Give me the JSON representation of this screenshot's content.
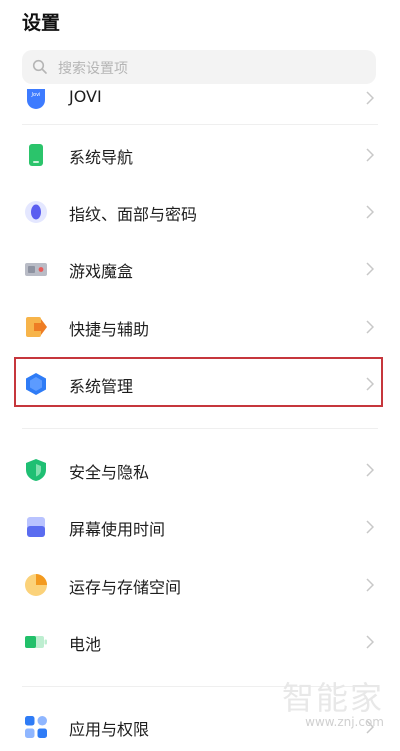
{
  "header": {
    "title": "设置"
  },
  "search": {
    "placeholder": "搜索设置项"
  },
  "menu": {
    "items": [
      {
        "label": "JOVI"
      },
      {
        "label": "系统导航"
      },
      {
        "label": "指纹、面部与密码"
      },
      {
        "label": "游戏魔盒"
      },
      {
        "label": "快捷与辅助"
      },
      {
        "label": "系统管理"
      },
      {
        "label": "安全与隐私"
      },
      {
        "label": "屏幕使用时间"
      },
      {
        "label": "运存与存储空间"
      },
      {
        "label": "电池"
      },
      {
        "label": "应用与权限"
      }
    ]
  },
  "watermark": {
    "brand": "智能家",
    "url": "www.znj.com"
  },
  "colors": {
    "highlight_border": "#c6363c",
    "search_bg": "#f3f3f3",
    "accent_blue": "#2f7cf6"
  }
}
